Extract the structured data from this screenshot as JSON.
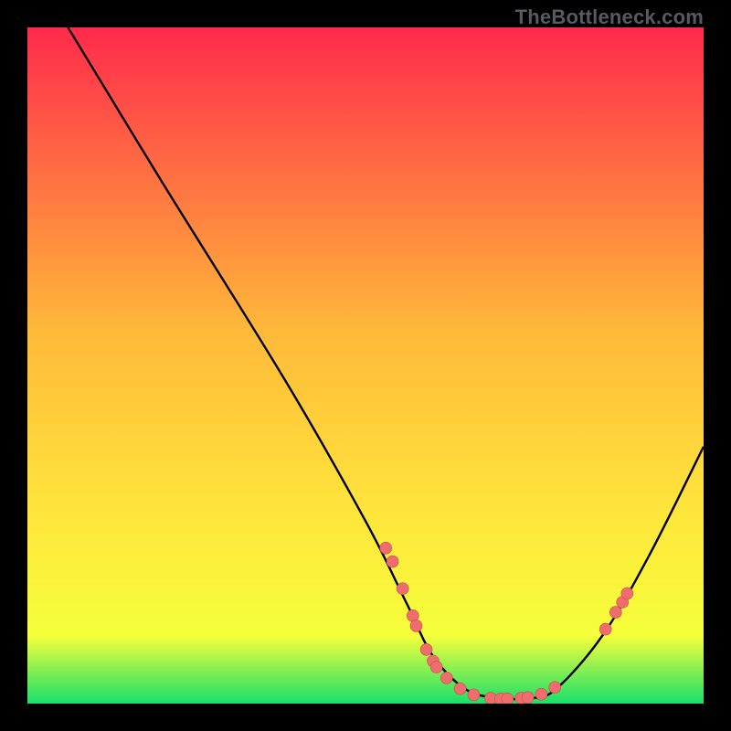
{
  "watermark": "TheBottleneck.com",
  "chart_data": {
    "type": "line",
    "title": "",
    "xlabel": "",
    "ylabel": "",
    "xlim": [
      0,
      100
    ],
    "ylim": [
      0,
      100
    ],
    "background_gradient": {
      "top": "#ff2a4b",
      "middle": "#ffe63b",
      "bottom": "#18e06a"
    },
    "curve": [
      {
        "x": 6,
        "y": 100
      },
      {
        "x": 20,
        "y": 77
      },
      {
        "x": 38,
        "y": 48
      },
      {
        "x": 50,
        "y": 27
      },
      {
        "x": 56,
        "y": 15
      },
      {
        "x": 60,
        "y": 7
      },
      {
        "x": 65,
        "y": 2
      },
      {
        "x": 70,
        "y": 0.8
      },
      {
        "x": 74,
        "y": 0.8
      },
      {
        "x": 78,
        "y": 2
      },
      {
        "x": 85,
        "y": 10
      },
      {
        "x": 92,
        "y": 22
      },
      {
        "x": 100,
        "y": 38
      }
    ],
    "scatter_points": [
      {
        "x": 53,
        "y": 23
      },
      {
        "x": 54,
        "y": 21
      },
      {
        "x": 55.5,
        "y": 17
      },
      {
        "x": 57,
        "y": 13
      },
      {
        "x": 57.5,
        "y": 11.5
      },
      {
        "x": 59,
        "y": 8
      },
      {
        "x": 60,
        "y": 6.3
      },
      {
        "x": 60.5,
        "y": 5.4
      },
      {
        "x": 62,
        "y": 3.8
      },
      {
        "x": 64,
        "y": 2.2
      },
      {
        "x": 66,
        "y": 1.3
      },
      {
        "x": 68.5,
        "y": 0.8
      },
      {
        "x": 70,
        "y": 0.7
      },
      {
        "x": 71,
        "y": 0.7
      },
      {
        "x": 73,
        "y": 0.8
      },
      {
        "x": 74,
        "y": 0.9
      },
      {
        "x": 76,
        "y": 1.4
      },
      {
        "x": 78,
        "y": 2.4
      },
      {
        "x": 85.5,
        "y": 11
      },
      {
        "x": 87,
        "y": 13.5
      },
      {
        "x": 88,
        "y": 15
      },
      {
        "x": 88.7,
        "y": 16.3
      }
    ],
    "marker_color": "#ef6d6c",
    "marker_border": "#c94b4b",
    "line_color": "#000000"
  }
}
